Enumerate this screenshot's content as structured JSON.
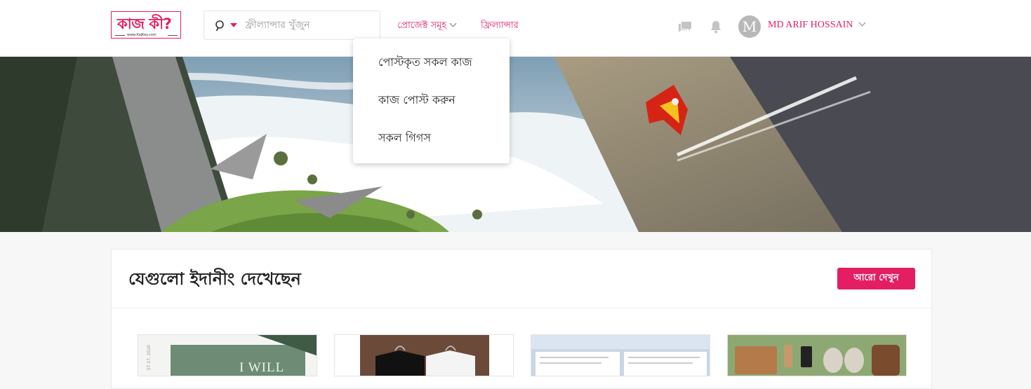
{
  "header": {
    "logo_text": "কাজ কী?",
    "logo_subtext": "www.KajKey.com",
    "search": {
      "placeholder": "ফ্রীল্যান্সার খুঁজুন"
    },
    "nav": {
      "projects_label": "প্রোজেক্ট সমূহ",
      "freelancer_label": "ফ্রিল্যান্সার"
    },
    "user": {
      "avatar_letter": "M",
      "name": "MD ARIF HOSSAIN"
    }
  },
  "dropdown": {
    "items": [
      {
        "label": "পোস্টকৃত সকল কাজ"
      },
      {
        "label": "কাজ পোস্ট করুন"
      },
      {
        "label": "সকল গিগস"
      }
    ]
  },
  "recent": {
    "title": "যেগুলো ইদানীং দেখেছেন",
    "more_button": "আরো দেখুন",
    "cards": [
      {
        "caption": "I WILL",
        "date": "ST 27, 2020"
      },
      {
        "caption": ""
      },
      {
        "caption": ""
      },
      {
        "caption": ""
      }
    ]
  },
  "colors": {
    "accent": "#e31e63",
    "hero_sky": "#9fb6c6"
  },
  "icons": [
    "search-icon",
    "chat-icon",
    "bell-icon",
    "chevron-down-icon"
  ]
}
